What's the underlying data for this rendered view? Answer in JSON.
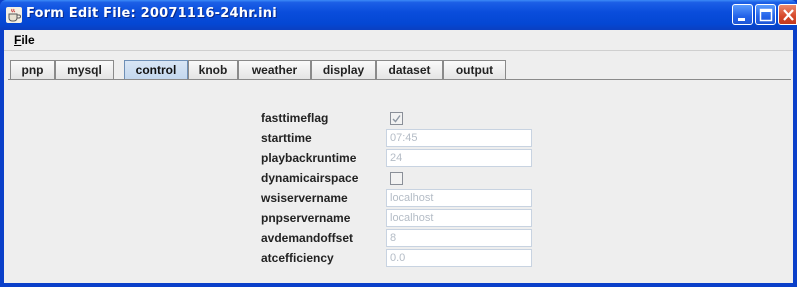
{
  "window": {
    "title": "Form Edit File: 20071116-24hr.ini",
    "icon": "java-cup-icon"
  },
  "menu": {
    "file_label": "File"
  },
  "tabs": [
    {
      "label": "pnp",
      "selected": false
    },
    {
      "label": "mysql",
      "selected": false
    },
    {
      "label": "control",
      "selected": true
    },
    {
      "label": "knob",
      "selected": false
    },
    {
      "label": "weather",
      "selected": false
    },
    {
      "label": "display",
      "selected": false
    },
    {
      "label": "dataset",
      "selected": false
    },
    {
      "label": "output",
      "selected": false
    }
  ],
  "form": {
    "fasttimeflag": {
      "label": "fasttimeflag",
      "checked": true
    },
    "starttime": {
      "label": "starttime",
      "value": "07:45"
    },
    "playbackruntime": {
      "label": "playbackruntime",
      "value": "24"
    },
    "dynamicairspace": {
      "label": "dynamicairspace",
      "checked": false
    },
    "wsiservername": {
      "label": "wsiservername",
      "value": "localhost"
    },
    "pnpservername": {
      "label": "pnpservername",
      "value": "localhost"
    },
    "avdemandoffset": {
      "label": "avdemandoffset",
      "value": "8"
    },
    "atcefficiency": {
      "label": "atcefficiency",
      "value": "0.0"
    }
  },
  "colors": {
    "titlebar": "#0447d3",
    "selected_tab": "#c3d7ee",
    "disabled_text": "#b4bcc6"
  }
}
